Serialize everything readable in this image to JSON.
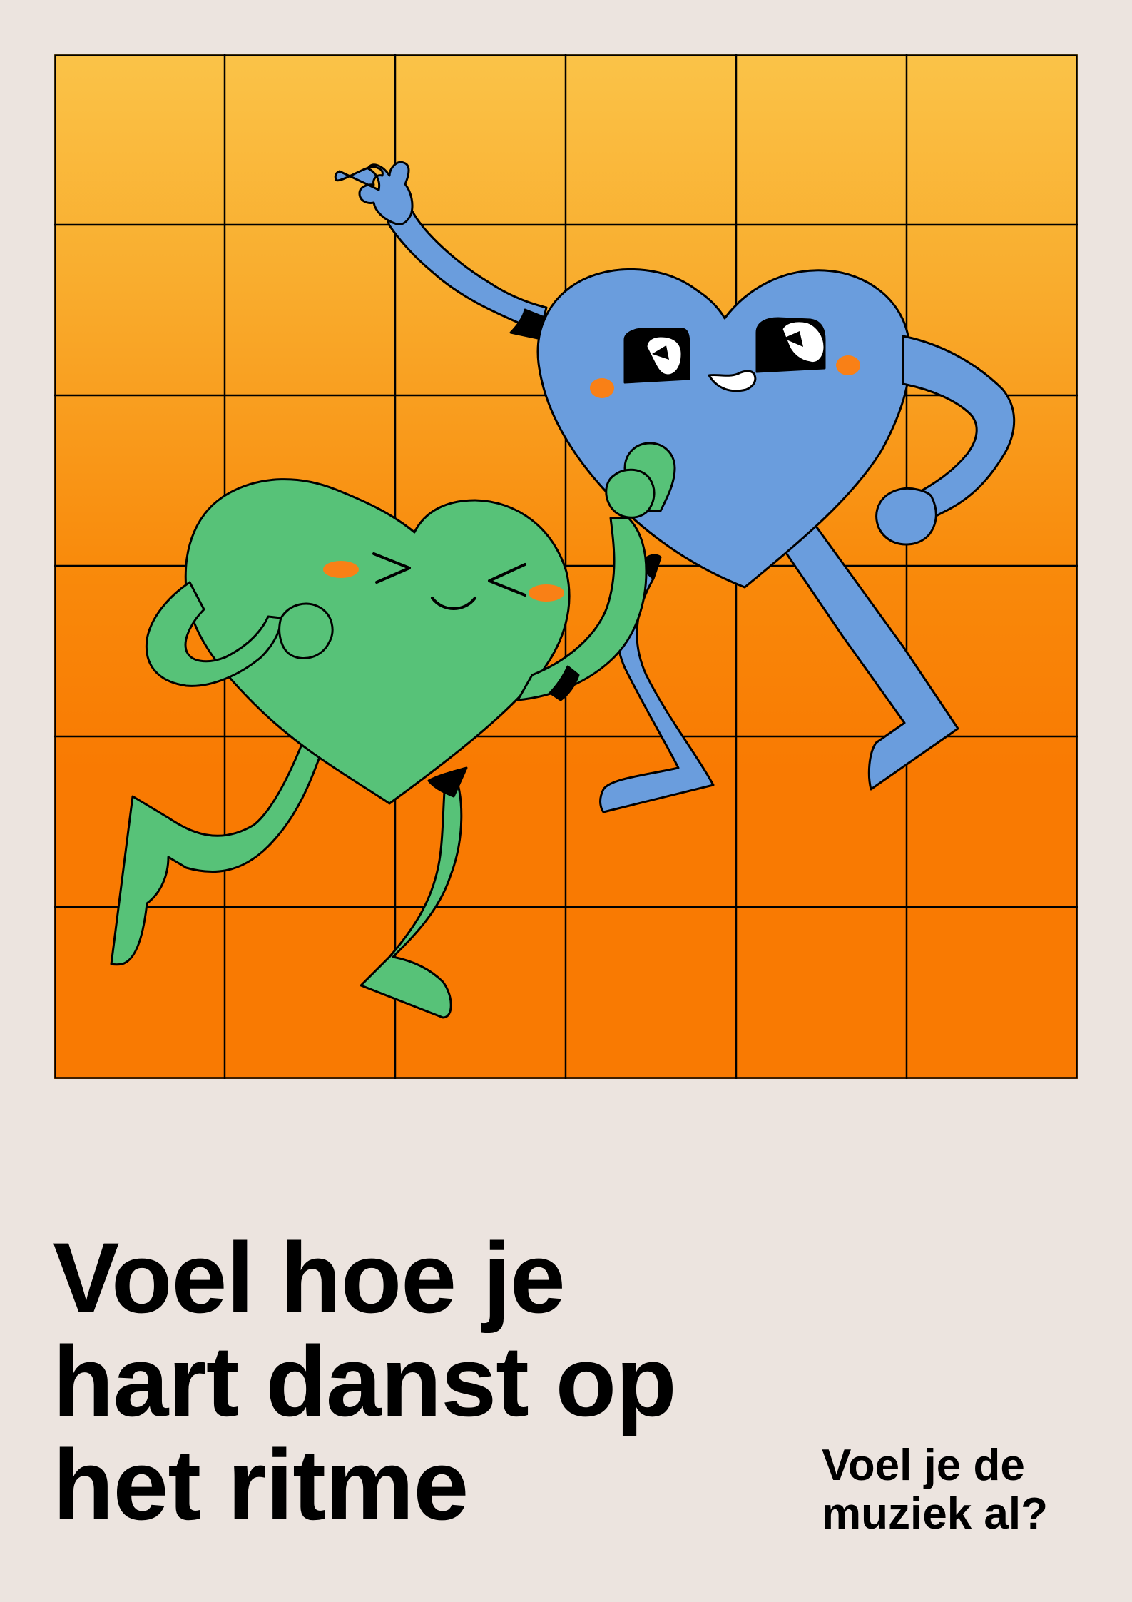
{
  "poster": {
    "headline_lines": [
      "Voel hoe je",
      "hart danst op",
      "het ritme"
    ],
    "tagline_lines": [
      "Voel je de",
      "muziek al?"
    ]
  },
  "colors": {
    "background": "#ece4df",
    "grid_top": "#fac348",
    "grid_bottom": "#f97a02",
    "green_heart": "#57c278",
    "blue_heart": "#6a9ddd",
    "blush": "#f98016",
    "outline": "#000000"
  },
  "illustration": {
    "grid": "6x6",
    "characters": [
      "green-heart-character",
      "blue-heart-character"
    ]
  }
}
